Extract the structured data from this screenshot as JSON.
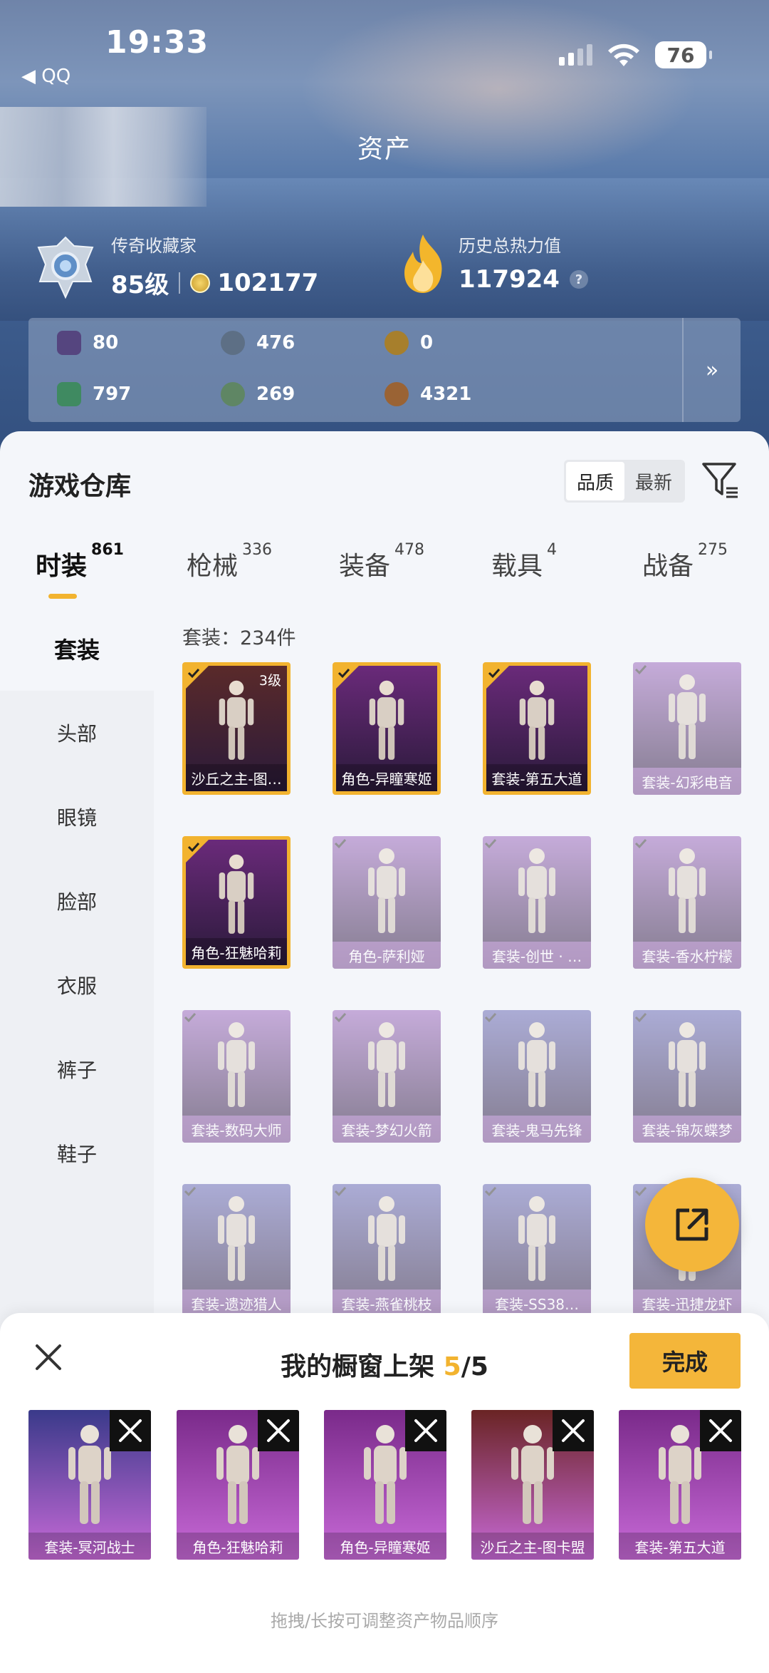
{
  "status_bar": {
    "time": "19:33",
    "back_label": "◀ QQ",
    "battery": "76"
  },
  "header": {
    "title": "资产"
  },
  "profile": {
    "rank_label": "传奇收藏家",
    "level": "85级",
    "points": "102177",
    "heat_label": "历史总热力值",
    "heat_value": "117924",
    "help": "?"
  },
  "resources": [
    {
      "icon": "card-icon",
      "value": "80",
      "color": "#5a4a8a"
    },
    {
      "icon": "token-icon",
      "value": "476",
      "color": "#5d6f85"
    },
    {
      "icon": "gold-medal-icon",
      "value": "0",
      "color": "#a77f2c"
    },
    {
      "icon": "green-card-icon",
      "value": "797",
      "color": "#3f8a61"
    },
    {
      "icon": "green-coin-icon",
      "value": "269",
      "color": "#5f8664"
    },
    {
      "icon": "bronze-coin-icon",
      "value": "4321",
      "color": "#9a6334"
    }
  ],
  "resources_more": "»",
  "warehouse": {
    "title": "游戏仓库",
    "sort_quality": "品质",
    "sort_newest": "最新",
    "tabs": [
      {
        "label": "时装",
        "count": "861"
      },
      {
        "label": "枪械",
        "count": "336"
      },
      {
        "label": "装备",
        "count": "478"
      },
      {
        "label": "载具",
        "count": "4"
      },
      {
        "label": "战备",
        "count": "275"
      }
    ],
    "sidebar": [
      "套装",
      "头部",
      "眼镜",
      "脸部",
      "衣服",
      "裤子",
      "鞋子"
    ],
    "caption": "套装：234件",
    "items": [
      {
        "label": "沙丘之主-图…",
        "level": "3级",
        "selected": true,
        "bg": "#5a2a2a"
      },
      {
        "label": "角色-异瞳寒姬",
        "selected": true,
        "bg": "#6a2a7a"
      },
      {
        "label": "套装-第五大道",
        "selected": true,
        "bg": "#6a2a7a"
      },
      {
        "label": "套装-幻彩电音",
        "selected": false,
        "bg": "#a06fc0"
      },
      {
        "label": "角色-狂魅哈莉",
        "selected": true,
        "bg": "#6a2a7a"
      },
      {
        "label": "角色-萨利娅",
        "selected": false,
        "bg": "#a06fc0"
      },
      {
        "label": "套装-创世 · …",
        "selected": false,
        "bg": "#a06fc0"
      },
      {
        "label": "套装-香水柠檬",
        "selected": false,
        "bg": "#a06fc0"
      },
      {
        "label": "套装-数码大师",
        "selected": false,
        "bg": "#a06fc0"
      },
      {
        "label": "套装-梦幻火箭",
        "selected": false,
        "bg": "#a06fc0"
      },
      {
        "label": "套装-鬼马先锋",
        "selected": false,
        "bg": "#7070b8"
      },
      {
        "label": "套装-锦灰蝶梦",
        "selected": false,
        "bg": "#7070b8"
      },
      {
        "label": "套装-遗迹猎人",
        "selected": false,
        "bg": "#7070b8"
      },
      {
        "label": "套装-燕雀桃枝",
        "selected": false,
        "bg": "#7070b8"
      },
      {
        "label": "套装-SS38…",
        "selected": false,
        "bg": "#7070b8"
      },
      {
        "label": "套装-迅捷龙虾",
        "selected": false,
        "bg": "#7070b8"
      }
    ]
  },
  "showcase": {
    "title": "我的橱窗上架",
    "current": "5",
    "total": "/5",
    "done_label": "完成",
    "items": [
      {
        "label": "套装-冥河战士",
        "bg": "#3a3a8a"
      },
      {
        "label": "角色-狂魅哈莉",
        "bg": "#7a2a8a"
      },
      {
        "label": "角色-异瞳寒姬",
        "bg": "#7a2a8a"
      },
      {
        "label": "沙丘之主-图卡盟",
        "bg": "#6a2424"
      },
      {
        "label": "套装-第五大道",
        "bg": "#7a2a8a"
      }
    ],
    "hint": "拖拽/长按可调整资产物品顺序"
  }
}
